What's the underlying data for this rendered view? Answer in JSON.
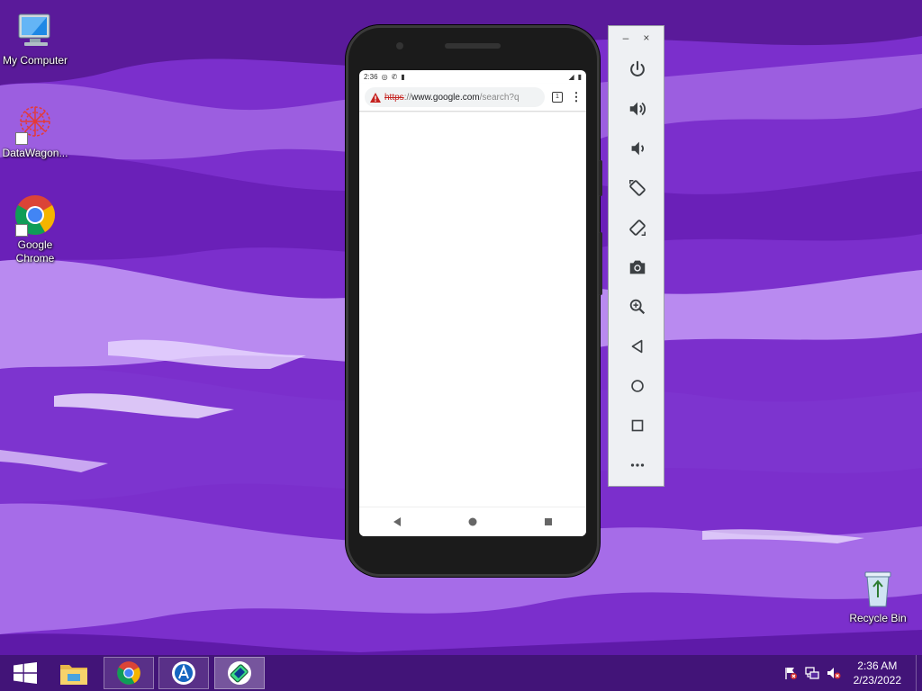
{
  "desktop": {
    "icons": [
      {
        "label": "My Computer",
        "icon": "computer-icon"
      },
      {
        "label": "DataWagon...",
        "icon": "datawagon-icon"
      },
      {
        "label": "Google Chrome",
        "icon": "chrome-icon"
      },
      {
        "label": "Recycle Bin",
        "icon": "recycle-bin-icon"
      }
    ]
  },
  "phone": {
    "status_time": "2:36",
    "browser": {
      "url_scheme": "https",
      "url_sep": "://",
      "url_host": "www.google.com",
      "url_path": "/search?q",
      "tab_count": "1",
      "security_icon": "warning-triangle-icon",
      "menu_icon": "more-vert-icon"
    },
    "nav": [
      "back-icon",
      "home-icon",
      "recents-icon"
    ]
  },
  "emulator_toolbar": {
    "minimize": "–",
    "close": "×",
    "buttons": [
      {
        "name": "power",
        "icon": "power-icon"
      },
      {
        "name": "volume-up",
        "icon": "volume-up-icon"
      },
      {
        "name": "volume-down",
        "icon": "volume-down-icon"
      },
      {
        "name": "rotate-left",
        "icon": "rotate-left-icon"
      },
      {
        "name": "rotate-right",
        "icon": "rotate-right-icon"
      },
      {
        "name": "screenshot",
        "icon": "camera-icon"
      },
      {
        "name": "zoom",
        "icon": "zoom-icon"
      },
      {
        "name": "back",
        "icon": "back-icon"
      },
      {
        "name": "home",
        "icon": "home-icon"
      },
      {
        "name": "overview",
        "icon": "overview-icon"
      },
      {
        "name": "more",
        "icon": "more-icon"
      }
    ]
  },
  "taskbar": {
    "items": [
      "start-icon",
      "file-explorer-icon",
      "chrome-icon",
      "android-studio-icon",
      "emulator-icon"
    ],
    "clock_time": "2:36 AM",
    "clock_date": "2/23/2022"
  },
  "colors": {
    "wallpaper": "#7a2fc9",
    "chrome_red": "#db4437",
    "chrome_green": "#0f9d58",
    "chrome_yellow": "#f4b400",
    "chrome_blue": "#4285f4",
    "warning_red": "#c5221f"
  }
}
